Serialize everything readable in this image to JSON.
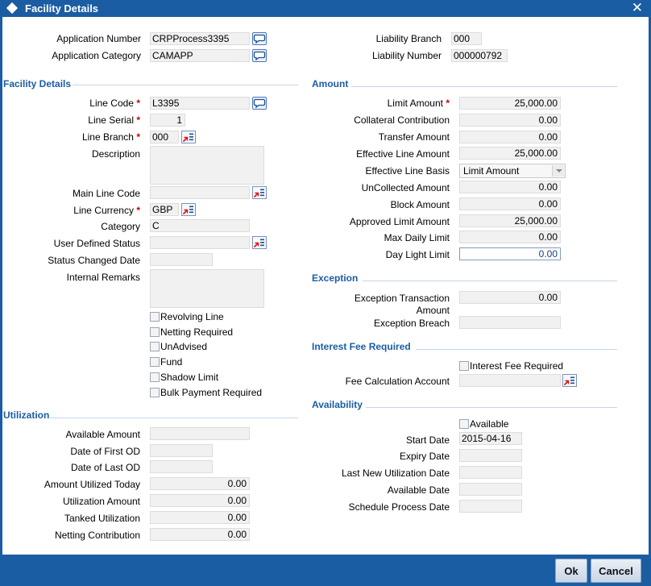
{
  "window": {
    "title": "Facility Details",
    "close": "✕"
  },
  "header": {
    "app_number_label": "Application Number",
    "app_number": "CRPProcess3395",
    "app_category_label": "Application Category",
    "app_category": "CAMAPP",
    "liab_branch_label": "Liability Branch",
    "liab_branch": "000",
    "liab_number_label": "Liability Number",
    "liab_number": "000000792"
  },
  "facility": {
    "section": "Facility Details",
    "line_code_label": "Line Code",
    "line_code": "L3395",
    "line_serial_label": "Line Serial",
    "line_serial": "1",
    "line_branch_label": "Line Branch",
    "line_branch": "000",
    "description_label": "Description",
    "description": "",
    "main_line_code_label": "Main Line Code",
    "main_line_code": "",
    "line_currency_label": "Line Currency",
    "line_currency": "GBP",
    "category_label": "Category",
    "category": "C",
    "uds_label": "User Defined Status",
    "uds": "",
    "status_changed_label": "Status Changed Date",
    "status_changed": "",
    "internal_remarks_label": "Internal Remarks",
    "internal_remarks": "",
    "checks": {
      "revolving": "Revolving Line",
      "netting": "Netting Required",
      "unadvised": "UnAdvised",
      "fund": "Fund",
      "shadow": "Shadow Limit",
      "bulk": "Bulk Payment Required"
    }
  },
  "amount": {
    "section": "Amount",
    "limit_label": "Limit Amount",
    "limit": "25,000.00",
    "collateral_label": "Collateral Contribution",
    "collateral": "0.00",
    "transfer_label": "Transfer Amount",
    "transfer": "0.00",
    "effective_label": "Effective Line Amount",
    "effective": "25,000.00",
    "basis_label": "Effective Line Basis",
    "basis": "Limit Amount",
    "uncollected_label": "UnCollected Amount",
    "uncollected": "0.00",
    "block_label": "Block Amount",
    "block": "0.00",
    "approved_label": "Approved Limit Amount",
    "approved": "25,000.00",
    "max_daily_label": "Max Daily Limit",
    "max_daily": "0.00",
    "daylight_label": "Day Light Limit",
    "daylight": "0.00"
  },
  "exception": {
    "section": "Exception",
    "txn_label_1": "Exception Transaction",
    "txn_label_2": "Amount",
    "txn": "0.00",
    "breach_label": "Exception Breach",
    "breach": ""
  },
  "interest": {
    "section": "Interest Fee Required",
    "check": "Interest Fee Required",
    "fee_account_label": "Fee Calculation Account",
    "fee_account": ""
  },
  "availability": {
    "section": "Availability",
    "check": "Available",
    "start_label": "Start Date",
    "start": "2015-04-16",
    "expiry_label": "Expiry Date",
    "expiry": "",
    "last_new_label": "Last New Utilization Date",
    "last_new": "",
    "avail_date_label": "Available Date",
    "avail_date": "",
    "schedule_label": "Schedule Process Date",
    "schedule": ""
  },
  "utilization": {
    "section": "Utilization",
    "available_label": "Available Amount",
    "available": "",
    "first_od_label": "Date of First OD",
    "first_od": "",
    "last_od_label": "Date of Last OD",
    "last_od": "",
    "utilized_today_label": "Amount Utilized Today",
    "utilized_today": "0.00",
    "utilization_label": "Utilization Amount",
    "utilization": "0.00",
    "tanked_label": "Tanked Utilization",
    "tanked": "0.00",
    "netting_label": "Netting Contribution",
    "netting": "0.00"
  },
  "footer": {
    "ok": "Ok",
    "cancel": "Cancel"
  },
  "colors": {
    "brand": "#1b5da3",
    "required": "#cc0000"
  },
  "icons": {
    "lov": "speech-bubble-icon",
    "picker": "arrow-list-icon"
  }
}
